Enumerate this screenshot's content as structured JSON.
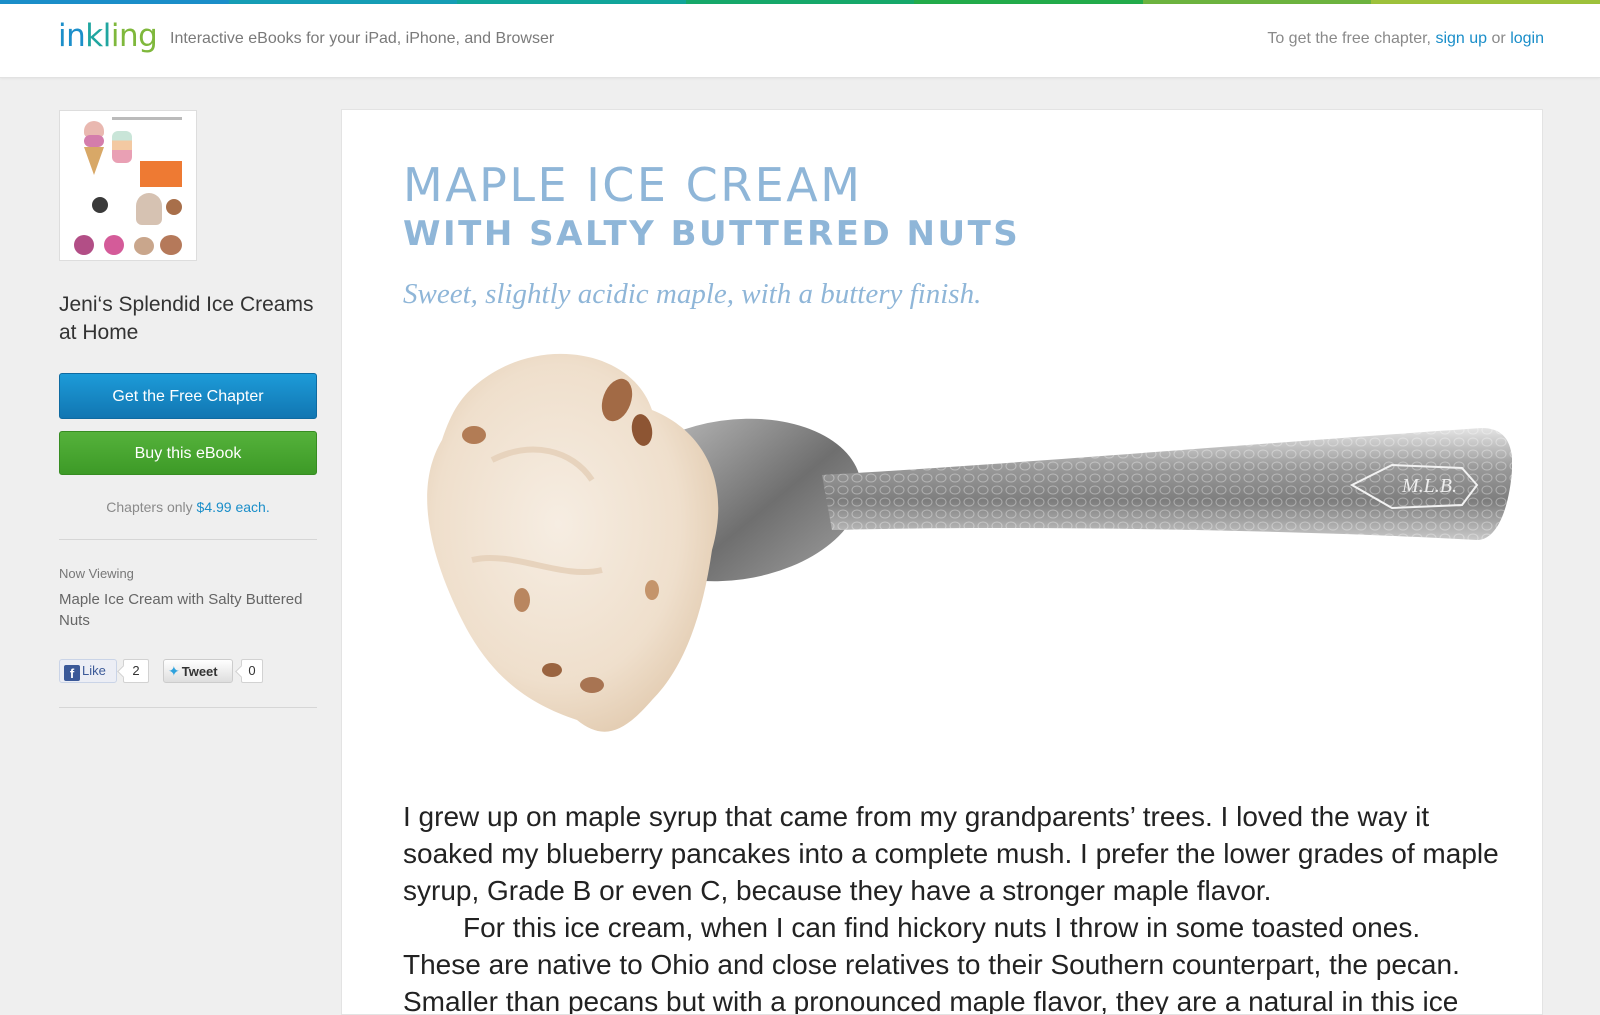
{
  "brand": {
    "logo_parts": [
      "in",
      "kl",
      "ing"
    ],
    "tagline": "Interactive eBooks for your iPad, iPhone, and Browser"
  },
  "account": {
    "prompt": "To get the free chapter,",
    "signup": "sign up",
    "or": "or",
    "login": "login"
  },
  "sidebar": {
    "book_title": "Jeni‘s Splendid Ice Creams at Home",
    "free_chapter_button": "Get the Free Chapter",
    "buy_button": "Buy this eBook",
    "price_prefix": "Chapters only",
    "price": "$4.99 each.",
    "now_viewing_label": "Now Viewing",
    "now_viewing_value": "Maple Ice Cream with Salty Buttered Nuts",
    "like_label": "Like",
    "like_count": "2",
    "tweet_label": "Tweet",
    "tweet_count": "0"
  },
  "recipe": {
    "title": "MAPLE ICE CREAM",
    "subtitle": "WITH SALTY BUTTERED NUTS",
    "tagline": "Sweet, slightly acidic maple, with a buttery finish.",
    "paragraphs": [
      "I grew up on maple syrup that came from my grandparents’ trees. I loved the way it soaked my blueberry pancakes into a complete mush. I prefer the lower grades of maple syrup, Grade B or even C, because they have a stronger maple flavor.",
      "For this ice cream, when I can find hickory nuts I throw in some toasted ones. These are native to Ohio and close relatives to their Southern counterpart, the pecan. Smaller than pecans but with a pronounced maple flavor, they are a natural in this ice cream."
    ],
    "spoon_engraving": "M.L.B."
  },
  "colors": {
    "accent_blue": "#1a8ec9",
    "title_blue": "#8fb6d8",
    "buy_green": "#45a52e"
  }
}
